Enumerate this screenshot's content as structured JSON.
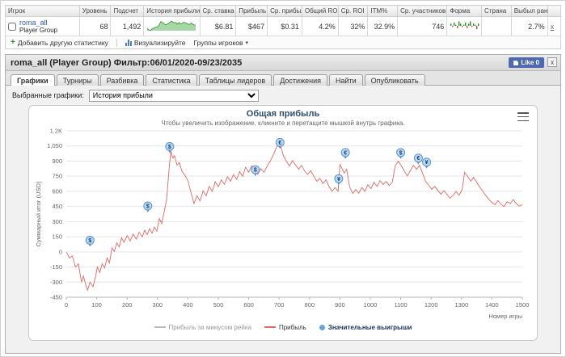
{
  "stats_table": {
    "headers": [
      "Игрок",
      "Уровень",
      "Подсчет",
      "История прибыли",
      "Ср. ставка",
      "Прибыль",
      "Ср. прибыль",
      "Общий ROI",
      "Ср. ROI",
      "ITM%",
      "Ср. участников",
      "Форма",
      "Страна",
      "Выбыл рано",
      ""
    ],
    "row": {
      "player": "roma_all",
      "player_sub": "Player Group",
      "level": "68",
      "count": "1,492",
      "avg_stake": "$6.81",
      "profit": "$467",
      "avg_profit": "$0.31",
      "total_roi": "4.2%",
      "avg_roi": "32%",
      "itm": "32.9%",
      "avg_entrants": "746",
      "country": "",
      "early_bust": "2.7%",
      "remove_label": "x"
    },
    "profit_sparkline": [
      0,
      -250,
      -380,
      -150,
      -50,
      100,
      160,
      220,
      520,
      1000,
      860,
      700,
      480,
      600,
      720,
      840,
      1080,
      900,
      800,
      860,
      600,
      870,
      640,
      700,
      900,
      850,
      700,
      620,
      560,
      790,
      600,
      470,
      467
    ],
    "form_sparkline": [
      2,
      -1,
      3,
      1,
      -2,
      4,
      2,
      -1,
      1,
      3,
      -2,
      2,
      4,
      -1,
      2,
      1,
      -3,
      2
    ]
  },
  "toolbar": {
    "add_stat": "Добавить другую статистику",
    "visualize": "Визуализируйте",
    "player_groups": "Группы игроков"
  },
  "panel": {
    "title": "roma_all (Player Group) Фильтр:06/01/2020-09/23/2035",
    "like_label": "Like 0",
    "close_label": "x",
    "tabs": [
      {
        "label": "Графики",
        "active": true
      },
      {
        "label": "Турниры",
        "active": false
      },
      {
        "label": "Разбивка",
        "active": false
      },
      {
        "label": "Статистика",
        "active": false
      },
      {
        "label": "Таблицы лидеров",
        "active": false
      },
      {
        "label": "Достижения",
        "active": false
      },
      {
        "label": "Найти",
        "active": false
      },
      {
        "label": "Опубликовать",
        "active": false
      }
    ],
    "graph_select_label": "Выбранные графики:",
    "graph_selected": "История прибыли"
  },
  "chart_data": {
    "type": "line",
    "title": "Общая прибыль",
    "subtitle": "Чтобы увеличить изображение, кликните и перетащите мышкой внутрь графика.",
    "ylabel": "Суммарный итог (USD)",
    "xlabel": "Номер игры",
    "xlim": [
      0,
      1500
    ],
    "ylim": [
      -450,
      1200
    ],
    "grid": "horizontal",
    "legend_position": "bottom",
    "y_ticks": [
      {
        "v": -450,
        "label": "-450"
      },
      {
        "v": -300,
        "label": "-300"
      },
      {
        "v": -150,
        "label": "-150"
      },
      {
        "v": 0,
        "label": "0"
      },
      {
        "v": 150,
        "label": "150"
      },
      {
        "v": 300,
        "label": "300"
      },
      {
        "v": 450,
        "label": "450"
      },
      {
        "v": 600,
        "label": "600"
      },
      {
        "v": 750,
        "label": "750"
      },
      {
        "v": 900,
        "label": "900"
      },
      {
        "v": 1050,
        "label": "1,050"
      },
      {
        "v": 1200,
        "label": "1.2K"
      }
    ],
    "x_ticks": [
      {
        "v": 0,
        "label": "0"
      },
      {
        "v": 100,
        "label": "100"
      },
      {
        "v": 200,
        "label": "200"
      },
      {
        "v": 300,
        "label": "300"
      },
      {
        "v": 400,
        "label": "400"
      },
      {
        "v": 500,
        "label": "500"
      },
      {
        "v": 600,
        "label": "600"
      },
      {
        "v": 700,
        "label": "700"
      },
      {
        "v": 800,
        "label": "800"
      },
      {
        "v": 900,
        "label": "900"
      },
      {
        "v": 1000,
        "label": "1000"
      },
      {
        "v": 1100,
        "label": "1100"
      },
      {
        "v": 1200,
        "label": "1200"
      },
      {
        "v": 1300,
        "label": "1300"
      },
      {
        "v": 1400,
        "label": "1400"
      },
      {
        "v": 1500,
        "label": "1500"
      }
    ],
    "series": [
      {
        "name": "Прибыль",
        "color": "#db6a65",
        "points": [
          [
            0,
            0
          ],
          [
            10,
            -60
          ],
          [
            20,
            -40
          ],
          [
            30,
            -150
          ],
          [
            40,
            -120
          ],
          [
            50,
            -300
          ],
          [
            56,
            -240
          ],
          [
            64,
            -330
          ],
          [
            70,
            -380
          ],
          [
            78,
            -300
          ],
          [
            88,
            -345
          ],
          [
            96,
            -250
          ],
          [
            102,
            -150
          ],
          [
            110,
            -205
          ],
          [
            118,
            -120
          ],
          [
            126,
            -160
          ],
          [
            134,
            -60
          ],
          [
            142,
            -110
          ],
          [
            150,
            40
          ],
          [
            158,
            5
          ],
          [
            166,
            90
          ],
          [
            174,
            50
          ],
          [
            182,
            140
          ],
          [
            190,
            95
          ],
          [
            200,
            160
          ],
          [
            210,
            110
          ],
          [
            220,
            175
          ],
          [
            230,
            125
          ],
          [
            240,
            195
          ],
          [
            250,
            150
          ],
          [
            258,
            215
          ],
          [
            266,
            170
          ],
          [
            274,
            230
          ],
          [
            282,
            185
          ],
          [
            290,
            245
          ],
          [
            298,
            205
          ],
          [
            306,
            330
          ],
          [
            314,
            280
          ],
          [
            322,
            400
          ],
          [
            330,
            520
          ],
          [
            338,
            820
          ],
          [
            344,
            1000
          ],
          [
            350,
            930
          ],
          [
            356,
            955
          ],
          [
            364,
            860
          ],
          [
            372,
            885
          ],
          [
            380,
            800
          ],
          [
            390,
            760
          ],
          [
            400,
            705
          ],
          [
            410,
            590
          ],
          [
            420,
            480
          ],
          [
            430,
            555
          ],
          [
            440,
            505
          ],
          [
            450,
            605
          ],
          [
            460,
            555
          ],
          [
            470,
            650
          ],
          [
            480,
            600
          ],
          [
            490,
            695
          ],
          [
            500,
            645
          ],
          [
            510,
            715
          ],
          [
            520,
            670
          ],
          [
            530,
            745
          ],
          [
            540,
            700
          ],
          [
            550,
            765
          ],
          [
            560,
            720
          ],
          [
            570,
            795
          ],
          [
            580,
            750
          ],
          [
            590,
            840
          ],
          [
            600,
            790
          ],
          [
            610,
            855
          ],
          [
            620,
            815
          ],
          [
            630,
            770
          ],
          [
            640,
            825
          ],
          [
            650,
            790
          ],
          [
            660,
            845
          ],
          [
            670,
            895
          ],
          [
            680,
            955
          ],
          [
            690,
            1025
          ],
          [
            700,
            1080
          ],
          [
            706,
            1045
          ],
          [
            714,
            950
          ],
          [
            724,
            900
          ],
          [
            734,
            850
          ],
          [
            744,
            905
          ],
          [
            754,
            860
          ],
          [
            764,
            820
          ],
          [
            774,
            858
          ],
          [
            784,
            800
          ],
          [
            794,
            768
          ],
          [
            804,
            806
          ],
          [
            814,
            750
          ],
          [
            824,
            700
          ],
          [
            834,
            728
          ],
          [
            844,
            678
          ],
          [
            854,
            715
          ],
          [
            864,
            648
          ],
          [
            874,
            600
          ],
          [
            884,
            638
          ],
          [
            894,
            600
          ],
          [
            900,
            865
          ],
          [
            906,
            830
          ],
          [
            914,
            782
          ],
          [
            922,
            818
          ],
          [
            932,
            645
          ],
          [
            942,
            580
          ],
          [
            952,
            618
          ],
          [
            962,
            582
          ],
          [
            972,
            638
          ],
          [
            982,
            600
          ],
          [
            992,
            665
          ],
          [
            1002,
            628
          ],
          [
            1012,
            688
          ],
          [
            1022,
            648
          ],
          [
            1032,
            706
          ],
          [
            1042,
            668
          ],
          [
            1052,
            698
          ],
          [
            1062,
            658
          ],
          [
            1072,
            688
          ],
          [
            1082,
            855
          ],
          [
            1092,
            898
          ],
          [
            1102,
            852
          ],
          [
            1112,
            800
          ],
          [
            1122,
            752
          ],
          [
            1132,
            808
          ],
          [
            1142,
            858
          ],
          [
            1152,
            818
          ],
          [
            1162,
            858
          ],
          [
            1172,
            778
          ],
          [
            1182,
            700
          ],
          [
            1192,
            660
          ],
          [
            1202,
            620
          ],
          [
            1212,
            650
          ],
          [
            1222,
            610
          ],
          [
            1232,
            572
          ],
          [
            1242,
            608
          ],
          [
            1252,
            570
          ],
          [
            1262,
            532
          ],
          [
            1272,
            560
          ],
          [
            1282,
            598
          ],
          [
            1292,
            562
          ],
          [
            1302,
            618
          ],
          [
            1310,
            788
          ],
          [
            1320,
            748
          ],
          [
            1330,
            700
          ],
          [
            1340,
            738
          ],
          [
            1350,
            690
          ],
          [
            1360,
            640
          ],
          [
            1370,
            600
          ],
          [
            1380,
            558
          ],
          [
            1390,
            520
          ],
          [
            1400,
            490
          ],
          [
            1410,
            468
          ],
          [
            1420,
            508
          ],
          [
            1430,
            470
          ],
          [
            1440,
            450
          ],
          [
            1450,
            498
          ],
          [
            1460,
            478
          ],
          [
            1470,
            518
          ],
          [
            1480,
            478
          ],
          [
            1490,
            455
          ],
          [
            1500,
            467
          ]
        ]
      }
    ],
    "markers": [
      {
        "x": 78,
        "y": 115,
        "symbol": "$"
      },
      {
        "x": 268,
        "y": 455,
        "symbol": "$"
      },
      {
        "x": 340,
        "y": 1045,
        "symbol": "$"
      },
      {
        "x": 622,
        "y": 815,
        "symbol": "$"
      },
      {
        "x": 703,
        "y": 1085,
        "symbol": "€"
      },
      {
        "x": 896,
        "y": 725,
        "symbol": "¥"
      },
      {
        "x": 918,
        "y": 985,
        "symbol": "€"
      },
      {
        "x": 1100,
        "y": 985,
        "symbol": "$"
      },
      {
        "x": 1158,
        "y": 930,
        "symbol": "€"
      },
      {
        "x": 1185,
        "y": 890,
        "symbol": "¥"
      }
    ],
    "legend": [
      {
        "label": "Прибыль за минусом рейка",
        "color": "#bcbcbc",
        "type": "line",
        "muted": true,
        "bold": false
      },
      {
        "label": "Прибыль",
        "color": "#db6a65",
        "type": "line",
        "muted": false,
        "bold": false
      },
      {
        "label": "Значительные выигрыши",
        "color": "#69a3d9",
        "type": "marker",
        "muted": false,
        "bold": true
      }
    ],
    "colors": {
      "line": "#db6a65",
      "marker_fill": "#b9d7f3",
      "marker_border": "#5b93c9",
      "grid": "#e6e6e6"
    }
  }
}
